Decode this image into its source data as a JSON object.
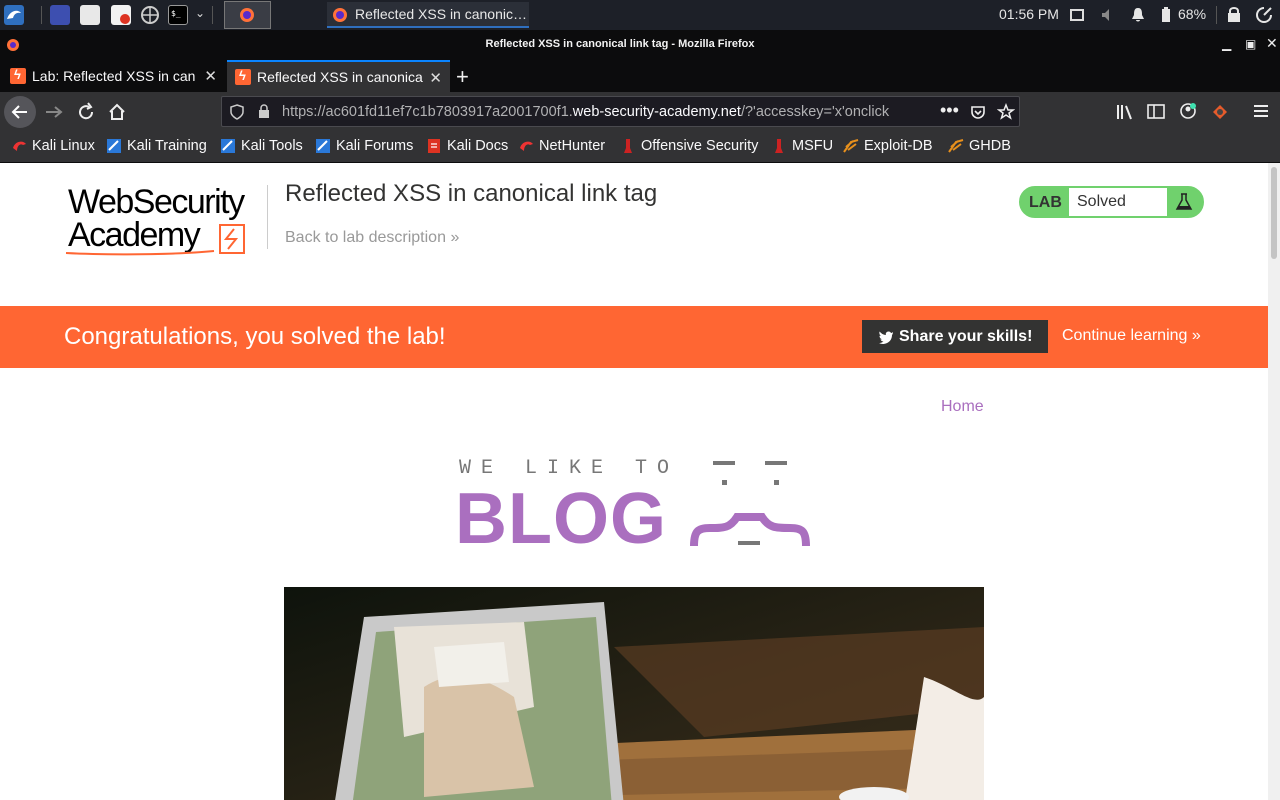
{
  "taskbar": {
    "window_title": "Reflected XSS in canonic…",
    "clock": "01:56 PM",
    "battery": "68%"
  },
  "window": {
    "title": "Reflected XSS in canonical link tag - Mozilla Firefox"
  },
  "tabs": [
    {
      "label": "Lab: Reflected XSS in can",
      "active": false
    },
    {
      "label": "Reflected XSS in canonica",
      "active": true
    }
  ],
  "urlbar": {
    "prefix": "https://ac601fd11ef7c1b7803917a2001700f1.",
    "domain": "web-security-academy.net",
    "suffix": "/?'accesskey='x'onclick"
  },
  "bookmarks": [
    {
      "label": "Kali Linux",
      "icon": "kali-dragon-icon"
    },
    {
      "label": "Kali Training",
      "icon": "kali-training-icon"
    },
    {
      "label": "Kali Tools",
      "icon": "kali-tools-icon"
    },
    {
      "label": "Kali Forums",
      "icon": "kali-forums-icon"
    },
    {
      "label": "Kali Docs",
      "icon": "kali-docs-icon"
    },
    {
      "label": "NetHunter",
      "icon": "nethunter-icon"
    },
    {
      "label": "Offensive Security",
      "icon": "offsec-icon"
    },
    {
      "label": "MSFU",
      "icon": "msfu-icon"
    },
    {
      "label": "Exploit-DB",
      "icon": "exploit-db-icon"
    },
    {
      "label": "GHDB",
      "icon": "ghdb-icon"
    }
  ],
  "header": {
    "logo_line1": "WebSecurity",
    "logo_line2": "Academy",
    "lab_title": "Reflected XSS in canonical link tag",
    "back_link": "Back to lab description",
    "badge_label": "LAB",
    "badge_status": "Solved"
  },
  "banner": {
    "message": "Congratulations, you solved the lab!",
    "share_label": "Share your skills!",
    "continue_label": "Continue learning"
  },
  "blog": {
    "home_link": "Home",
    "tagline": "WE LIKE TO",
    "title": "BLOG"
  },
  "colors": {
    "accent_orange": "#ff6633",
    "blog_purple": "#aa6fbf",
    "solved_green": "#70d16d"
  }
}
